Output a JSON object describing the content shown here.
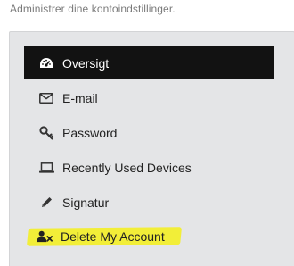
{
  "page": {
    "description": "Administrer dine kontoindstillinger."
  },
  "menu": {
    "items": [
      {
        "label": "Oversigt",
        "icon": "dashboard-icon",
        "active": true
      },
      {
        "label": "E-mail",
        "icon": "envelope-icon",
        "active": false
      },
      {
        "label": "Password",
        "icon": "key-icon",
        "active": false
      },
      {
        "label": "Recently Used Devices",
        "icon": "laptop-icon",
        "active": false
      },
      {
        "label": "Signatur",
        "icon": "pencil-icon",
        "active": false
      },
      {
        "label": "Delete My Account",
        "icon": "user-delete-icon",
        "active": false,
        "highlighted": true
      }
    ]
  },
  "colors": {
    "active_bg": "#121212",
    "panel_bg": "#e4e5e7",
    "highlight": "#f2ee38"
  }
}
